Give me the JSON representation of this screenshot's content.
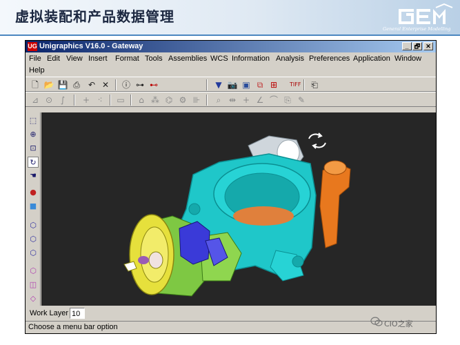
{
  "slide": {
    "title": "虚拟装配和产品数据管理",
    "logo_caption": "General Enterprise Modelling"
  },
  "window": {
    "app_icon": "UG",
    "title": "Unigraphics V16.0 - Gateway",
    "controls": [
      "_",
      "🗗",
      "✕"
    ]
  },
  "menu": {
    "items": [
      "File",
      "Edit",
      "View",
      "Insert",
      "Format",
      "Tools",
      "Assemblies",
      "WCS",
      "Information",
      "Analysis",
      "Preferences",
      "Application",
      "Window",
      "Help"
    ]
  },
  "toolbar1": {
    "icons": [
      "new-file-icon",
      "open-folder-icon",
      "save-icon",
      "print-icon",
      "undo-icon",
      "cut-icon",
      "info-icon",
      "tree-icon",
      "tree-icon-2",
      "funnel-icon",
      "camera-icon",
      "render-icon",
      "layer-icon",
      "tiff-icon",
      "export-icon"
    ]
  },
  "toolbar2": {
    "icons": [
      "sketch-icon",
      "point-icon",
      "curve-icon",
      "plus-icon",
      "point-set-icon",
      "rect-icon",
      "feature-icon",
      "pattern-icon",
      "chamfer-icon",
      "wrap-icon",
      "measure-icon",
      "trim-icon",
      "intersect-icon",
      "angle-icon",
      "fillet-icon",
      "sheet-icon",
      "edit-icon"
    ]
  },
  "left_tools": {
    "icons": [
      "zoom-window-icon",
      "zoom-icon",
      "fit-icon",
      "rotate-icon",
      "pan-icon",
      "shaded-icon",
      "box-icon",
      "wireframe-icon",
      "wireframe-icon-2",
      "wireframe-icon-3",
      "hidden-icon",
      "edges-icon",
      "face-icon"
    ]
  },
  "status": {
    "work_layer_label": "Work Layer",
    "work_layer_value": "10",
    "prompt": "Choose a menu bar option"
  },
  "watermark": "CIO之家",
  "colors": {
    "titlebar_start": "#0a246a",
    "titlebar_end": "#a6caf0",
    "viewport_bg": "#262626",
    "body_cyan": "#1fc7c9",
    "part_orange": "#e8781e",
    "part_yellow": "#e6e03c",
    "part_green": "#7ec843",
    "part_blue": "#3a3ad8"
  }
}
